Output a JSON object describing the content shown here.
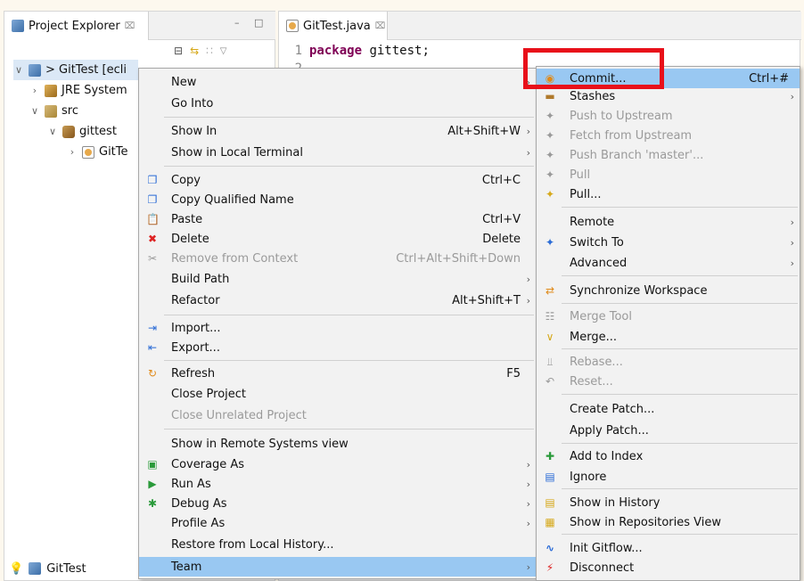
{
  "explorer": {
    "title": "Project Explorer",
    "close_glyph": "⌧",
    "toolbar_icons": [
      "collapse-all-icon",
      "link-with-editor-icon",
      "filter-icon",
      "view-menu-icon"
    ],
    "tree": [
      {
        "label": "> GitTest [ecli",
        "icon": "project-icon"
      },
      {
        "label": "JRE System",
        "icon": "jre-library-icon"
      },
      {
        "label": "src",
        "icon": "source-folder-icon"
      },
      {
        "label": "gittest",
        "icon": "package-icon"
      },
      {
        "label": "GitTe",
        "icon": "java-file-icon"
      }
    ],
    "status_label": "GitTest"
  },
  "editor": {
    "tab_title": "GitTest.java",
    "close_glyph": "⌧",
    "lines": [
      {
        "num": "1",
        "keyword": "package",
        "rest": " gittest;"
      },
      {
        "num": "2",
        "keyword": "",
        "rest": ""
      }
    ]
  },
  "main_menu": {
    "items": [
      {
        "label": "New",
        "shortcut": "",
        "submenu": true,
        "icon": ""
      },
      {
        "label": "Go Into",
        "shortcut": "",
        "submenu": false,
        "icon": ""
      },
      {
        "label": "Show In",
        "shortcut": "Alt+Shift+W",
        "submenu": true,
        "icon": ""
      },
      {
        "label": "Show in Local Terminal",
        "shortcut": "",
        "submenu": true,
        "icon": ""
      },
      {
        "label": "Copy",
        "shortcut": "Ctrl+C",
        "submenu": false,
        "icon": "copy-icon"
      },
      {
        "label": "Copy Qualified Name",
        "shortcut": "",
        "submenu": false,
        "icon": "copy-qualified-name-icon"
      },
      {
        "label": "Paste",
        "shortcut": "Ctrl+V",
        "submenu": false,
        "icon": "paste-icon"
      },
      {
        "label": "Delete",
        "shortcut": "Delete",
        "submenu": false,
        "icon": "delete-icon"
      },
      {
        "label": "Remove from Context",
        "shortcut": "Ctrl+Alt+Shift+Down",
        "submenu": false,
        "icon": "remove-context-icon",
        "disabled": true
      },
      {
        "label": "Build Path",
        "shortcut": "",
        "submenu": true,
        "icon": ""
      },
      {
        "label": "Refactor",
        "shortcut": "Alt+Shift+T",
        "submenu": true,
        "icon": ""
      },
      {
        "label": "Import...",
        "shortcut": "",
        "submenu": false,
        "icon": "import-icon"
      },
      {
        "label": "Export...",
        "shortcut": "",
        "submenu": false,
        "icon": "export-icon"
      },
      {
        "label": "Refresh",
        "shortcut": "F5",
        "submenu": false,
        "icon": "refresh-icon"
      },
      {
        "label": "Close Project",
        "shortcut": "",
        "submenu": false,
        "icon": ""
      },
      {
        "label": "Close Unrelated Project",
        "shortcut": "",
        "submenu": false,
        "icon": "",
        "disabled": true
      },
      {
        "label": "Show in Remote Systems view",
        "shortcut": "",
        "submenu": false,
        "icon": ""
      },
      {
        "label": "Coverage As",
        "shortcut": "",
        "submenu": true,
        "icon": "coverage-icon"
      },
      {
        "label": "Run As",
        "shortcut": "",
        "submenu": true,
        "icon": "run-icon"
      },
      {
        "label": "Debug As",
        "shortcut": "",
        "submenu": true,
        "icon": "debug-icon"
      },
      {
        "label": "Profile As",
        "shortcut": "",
        "submenu": true,
        "icon": ""
      },
      {
        "label": "Restore from Local History...",
        "shortcut": "",
        "submenu": false,
        "icon": ""
      },
      {
        "label": "Team",
        "shortcut": "",
        "submenu": true,
        "icon": "",
        "highlighted": true
      }
    ]
  },
  "team_menu": {
    "items": [
      {
        "label": "Commit...",
        "shortcut": "Ctrl+#",
        "submenu": false,
        "icon": "commit-icon",
        "highlighted": true
      },
      {
        "label": "Stashes",
        "shortcut": "",
        "submenu": true,
        "icon": "stashes-icon"
      },
      {
        "label": "Push to Upstream",
        "shortcut": "",
        "submenu": false,
        "icon": "push-upstream-icon",
        "disabled": true
      },
      {
        "label": "Fetch from Upstream",
        "shortcut": "",
        "submenu": false,
        "icon": "fetch-upstream-icon",
        "disabled": true
      },
      {
        "label": "Push Branch 'master'...",
        "shortcut": "",
        "submenu": false,
        "icon": "push-branch-icon",
        "disabled": true
      },
      {
        "label": "Pull",
        "shortcut": "",
        "submenu": false,
        "icon": "pull-icon",
        "disabled": true
      },
      {
        "label": "Pull...",
        "shortcut": "",
        "submenu": false,
        "icon": "pull-dialog-icon"
      },
      {
        "label": "Remote",
        "shortcut": "",
        "submenu": true,
        "icon": ""
      },
      {
        "label": "Switch To",
        "shortcut": "",
        "submenu": true,
        "icon": "switch-branch-icon"
      },
      {
        "label": "Advanced",
        "shortcut": "",
        "submenu": true,
        "icon": ""
      },
      {
        "label": "Synchronize Workspace",
        "shortcut": "",
        "submenu": false,
        "icon": "synchronize-icon"
      },
      {
        "label": "Merge Tool",
        "shortcut": "",
        "submenu": false,
        "icon": "merge-tool-icon",
        "disabled": true
      },
      {
        "label": "Merge...",
        "shortcut": "",
        "submenu": false,
        "icon": "merge-icon"
      },
      {
        "label": "Rebase...",
        "shortcut": "",
        "submenu": false,
        "icon": "rebase-icon",
        "disabled": true
      },
      {
        "label": "Reset...",
        "shortcut": "",
        "submenu": false,
        "icon": "reset-icon",
        "disabled": true
      },
      {
        "label": "Create Patch...",
        "shortcut": "",
        "submenu": false,
        "icon": ""
      },
      {
        "label": "Apply Patch...",
        "shortcut": "",
        "submenu": false,
        "icon": ""
      },
      {
        "label": "Add to Index",
        "shortcut": "",
        "submenu": false,
        "icon": "add-to-index-icon"
      },
      {
        "label": "Ignore",
        "shortcut": "",
        "submenu": false,
        "icon": "ignore-icon"
      },
      {
        "label": "Show in History",
        "shortcut": "",
        "submenu": false,
        "icon": "history-icon"
      },
      {
        "label": "Show in Repositories View",
        "shortcut": "",
        "submenu": false,
        "icon": "repositories-icon"
      },
      {
        "label": "Init Gitflow...",
        "shortcut": "",
        "submenu": false,
        "icon": "gitflow-icon"
      },
      {
        "label": "Disconnect",
        "shortcut": "",
        "submenu": false,
        "icon": "disconnect-icon"
      }
    ]
  },
  "colors": {
    "highlight": "#99c8f2",
    "annotation_frame": "#e8101a",
    "menu_bg": "#f2f2f2",
    "keyword": "#7f0055"
  }
}
